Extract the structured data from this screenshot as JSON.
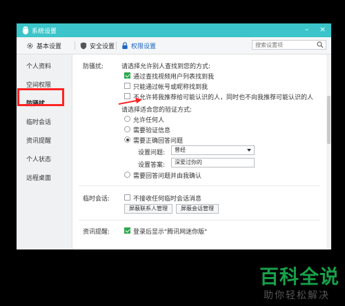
{
  "window": {
    "title": "系统设置",
    "controls": {
      "minimize": "–",
      "close": "×"
    }
  },
  "toolbar": {
    "tabs": [
      {
        "label": "基本设置",
        "icon": "gear-icon"
      },
      {
        "label": "安全设置",
        "icon": "shield-icon"
      },
      {
        "label": "权限设置",
        "icon": "lock-icon",
        "active": true
      }
    ],
    "search_placeholder": "搜索设置项"
  },
  "sidebar": {
    "items": [
      {
        "label": "个人资料"
      },
      {
        "label": "空间权限"
      },
      {
        "label": "防骚扰",
        "active": true
      },
      {
        "label": "临时会话"
      },
      {
        "label": "资讯提醒"
      },
      {
        "label": "个人状态"
      },
      {
        "label": "远程桌面"
      }
    ]
  },
  "anti_harass": {
    "section_label": "防骚扰:",
    "find_prompt": "请选择允许别人查找到您的方式:",
    "find_options": [
      {
        "label": "通过查找视频用户列表找到我",
        "checked": true
      },
      {
        "label": "只能通过帐号或昵称找到我",
        "checked": false
      },
      {
        "label": "不允许将我推荐给可能认识的人，同时也不向我推荐可能认识的人",
        "checked": false
      }
    ],
    "verify_prompt": "请选择适合您的验证方式:",
    "verify_options": [
      {
        "label": "允许任何人",
        "checked": false
      },
      {
        "label": "需要验证信息",
        "checked": false
      },
      {
        "label": "需要正确回答问题",
        "checked": true
      },
      {
        "label": "需要回答问题并由我确认",
        "checked": false
      }
    ],
    "question_label": "设置问题:",
    "question_value": "曾经",
    "answer_label": "设置答案:",
    "answer_value": "深爱过你的"
  },
  "temp_session": {
    "section_label": "临时会话:",
    "option": {
      "label": "不接收任何临时会话消息",
      "checked": false
    },
    "buttons": {
      "block_contacts": "屏蔽联系人管理",
      "block_sessions": "屏蔽会话管理"
    }
  },
  "news_alert": {
    "section_label": "资讯提醒:",
    "option": {
      "label": "登录后显示\"腾讯网迷你版\"",
      "checked": true
    }
  },
  "watermark": {
    "title": "百科全说",
    "subtitle": "助你轻松解决"
  },
  "colors": {
    "titlebar": "#3bc4c9",
    "accent": "#1a66c2",
    "check_green": "#2ea84f",
    "highlight_red": "#ff2323",
    "watermark_green": "#17a04a"
  }
}
